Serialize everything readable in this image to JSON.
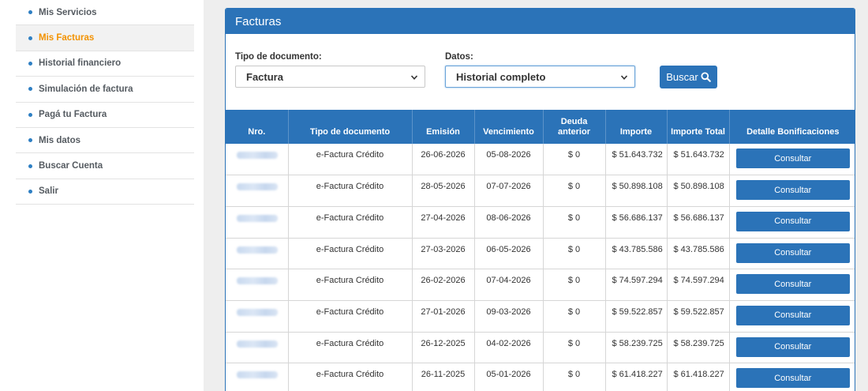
{
  "sidebar": {
    "items": [
      {
        "label": "Mis Servicios"
      },
      {
        "label": "Mis Facturas"
      },
      {
        "label": "Historial financiero"
      },
      {
        "label": "Simulación de factura"
      },
      {
        "label": "Pagá tu Factura"
      },
      {
        "label": "Mis datos"
      },
      {
        "label": "Buscar Cuenta"
      },
      {
        "label": "Salir"
      }
    ],
    "active_index": 1
  },
  "panel": {
    "title": "Facturas",
    "tipo_label": "Tipo de documento:",
    "tipo_value": "Factura",
    "datos_label": "Datos:",
    "datos_value": "Historial completo",
    "buscar_label": "Buscar"
  },
  "table": {
    "headers": {
      "nro": "Nro.",
      "tipo": "Tipo de documento",
      "emision": "Emisión",
      "vencimiento": "Vencimiento",
      "deuda_1": "Deuda",
      "deuda_2": "anterior",
      "importe": "Importe",
      "importe_total": "Importe Total",
      "detalle": "Detalle Bonificaciones"
    },
    "consultar_label": "Consultar",
    "rows": [
      {
        "tipo": "e-Factura Crédito",
        "emision": "26-06-2026",
        "vencimiento": "05-08-2026",
        "deuda": "$ 0",
        "importe": "$ 51.643.732",
        "total": "$ 51.643.732"
      },
      {
        "tipo": "e-Factura Crédito",
        "emision": "28-05-2026",
        "vencimiento": "07-07-2026",
        "deuda": "$ 0",
        "importe": "$ 50.898.108",
        "total": "$ 50.898.108"
      },
      {
        "tipo": "e-Factura Crédito",
        "emision": "27-04-2026",
        "vencimiento": "08-06-2026",
        "deuda": "$ 0",
        "importe": "$ 56.686.137",
        "total": "$ 56.686.137"
      },
      {
        "tipo": "e-Factura Crédito",
        "emision": "27-03-2026",
        "vencimiento": "06-05-2026",
        "deuda": "$ 0",
        "importe": "$ 43.785.586",
        "total": "$ 43.785.586"
      },
      {
        "tipo": "e-Factura Crédito",
        "emision": "26-02-2026",
        "vencimiento": "07-04-2026",
        "deuda": "$ 0",
        "importe": "$ 74.597.294",
        "total": "$ 74.597.294"
      },
      {
        "tipo": "e-Factura Crédito",
        "emision": "27-01-2026",
        "vencimiento": "09-03-2026",
        "deuda": "$ 0",
        "importe": "$ 59.522.857",
        "total": "$ 59.522.857"
      },
      {
        "tipo": "e-Factura Crédito",
        "emision": "26-12-2025",
        "vencimiento": "04-02-2026",
        "deuda": "$ 0",
        "importe": "$ 58.239.725",
        "total": "$ 58.239.725"
      },
      {
        "tipo": "e-Factura Crédito",
        "emision": "26-11-2025",
        "vencimiento": "05-01-2026",
        "deuda": "$ 0",
        "importe": "$ 61.418.227",
        "total": "$ 61.418.227"
      }
    ]
  },
  "colors": {
    "accent": "#2b73b8",
    "active_nav": "#f39200"
  }
}
